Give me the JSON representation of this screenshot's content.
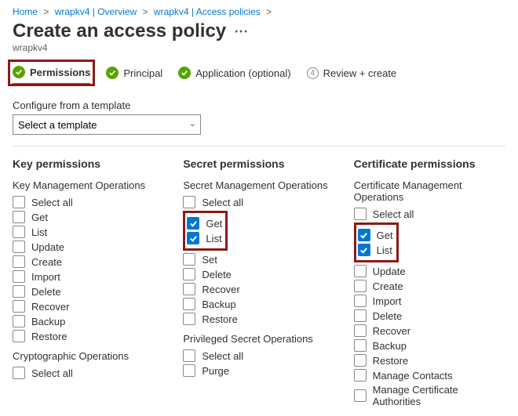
{
  "breadcrumb": {
    "items": [
      "Home",
      "wrapkv4 | Overview",
      "wrapkv4 | Access policies"
    ],
    "sep": ">"
  },
  "page": {
    "title": "Create an access policy",
    "subtitle": "wrapkv4"
  },
  "stepper": {
    "permissions": "Permissions",
    "principal": "Principal",
    "application": "Application (optional)",
    "review_num": "4",
    "review": "Review + create"
  },
  "template": {
    "label": "Configure from a template",
    "placeholder": "Select a template"
  },
  "columns": {
    "key": {
      "heading": "Key permissions",
      "groups": [
        {
          "label": "Key Management Operations",
          "select_all": "Select all",
          "items": [
            {
              "label": "Get",
              "checked": false
            },
            {
              "label": "List",
              "checked": false
            },
            {
              "label": "Update",
              "checked": false
            },
            {
              "label": "Create",
              "checked": false
            },
            {
              "label": "Import",
              "checked": false
            },
            {
              "label": "Delete",
              "checked": false
            },
            {
              "label": "Recover",
              "checked": false
            },
            {
              "label": "Backup",
              "checked": false
            },
            {
              "label": "Restore",
              "checked": false
            }
          ]
        },
        {
          "label": "Cryptographic Operations",
          "select_all": "Select all",
          "items": []
        }
      ]
    },
    "secret": {
      "heading": "Secret permissions",
      "groups": [
        {
          "label": "Secret Management Operations",
          "select_all": "Select all",
          "highlight_first_two": true,
          "items": [
            {
              "label": "Get",
              "checked": true
            },
            {
              "label": "List",
              "checked": true
            },
            {
              "label": "Set",
              "checked": false
            },
            {
              "label": "Delete",
              "checked": false
            },
            {
              "label": "Recover",
              "checked": false
            },
            {
              "label": "Backup",
              "checked": false
            },
            {
              "label": "Restore",
              "checked": false
            }
          ]
        },
        {
          "label": "Privileged Secret Operations",
          "select_all": "Select all",
          "items": [
            {
              "label": "Purge",
              "checked": false
            }
          ]
        }
      ]
    },
    "cert": {
      "heading": "Certificate permissions",
      "groups": [
        {
          "label": "Certificate Management Operations",
          "select_all": "Select all",
          "highlight_first_two": true,
          "items": [
            {
              "label": "Get",
              "checked": true
            },
            {
              "label": "List",
              "checked": true
            },
            {
              "label": "Update",
              "checked": false
            },
            {
              "label": "Create",
              "checked": false
            },
            {
              "label": "Import",
              "checked": false
            },
            {
              "label": "Delete",
              "checked": false
            },
            {
              "label": "Recover",
              "checked": false
            },
            {
              "label": "Backup",
              "checked": false
            },
            {
              "label": "Restore",
              "checked": false
            },
            {
              "label": "Manage Contacts",
              "checked": false
            },
            {
              "label": "Manage Certificate Authorities",
              "checked": false
            }
          ]
        }
      ]
    }
  }
}
